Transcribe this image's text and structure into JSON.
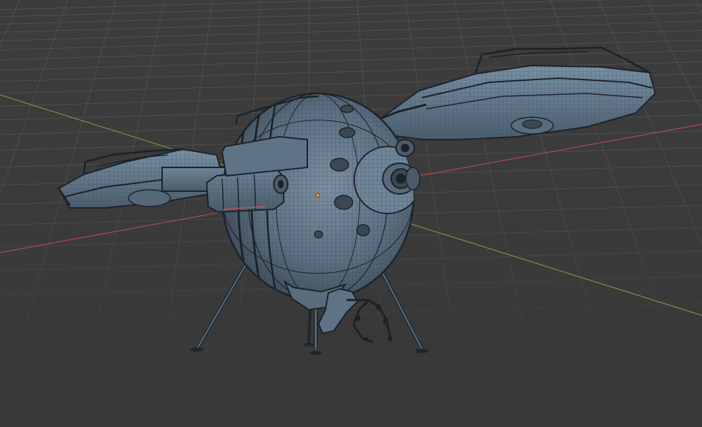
{
  "viewport": {
    "mode": "wireframe-overlay",
    "background_color": "#3a3a3a",
    "grid_color": "#555555",
    "x_axis_color": "#b9484e",
    "y_axis_color": "#6d9a3c",
    "origin_color": "#ff9a1f"
  },
  "model": {
    "kind": "spherical-drone-with-rotors",
    "wire_color": "#30404f",
    "shade_color": "#5f7386",
    "dark_edge_color": "#1b2228"
  }
}
